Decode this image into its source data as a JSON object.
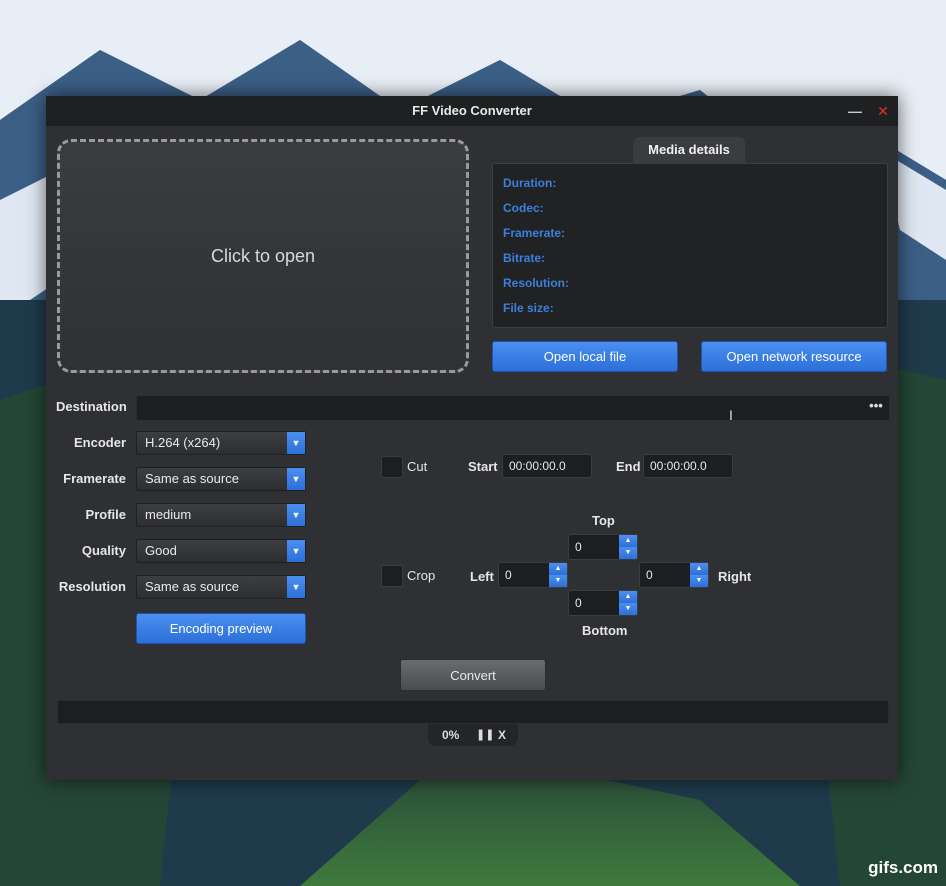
{
  "window": {
    "title": "FF Video Converter",
    "minimize_icon": "minimize-icon",
    "close_icon": "close-icon"
  },
  "dropzone": {
    "label": "Click to open"
  },
  "media_details": {
    "tab_label": "Media details",
    "rows": [
      "Duration:",
      "Codec:",
      "Framerate:",
      "Bitrate:",
      "Resolution:",
      "File size:"
    ]
  },
  "buttons": {
    "open_local": "Open local file",
    "open_network": "Open network resource",
    "encoding_preview": "Encoding preview",
    "convert": "Convert"
  },
  "destination": {
    "label": "Destination",
    "value": "",
    "browse": "•••"
  },
  "settings": {
    "encoder": {
      "label": "Encoder",
      "value": "H.264 (x264)"
    },
    "framerate": {
      "label": "Framerate",
      "value": "Same as source"
    },
    "profile": {
      "label": "Profile",
      "value": "medium"
    },
    "quality": {
      "label": "Quality",
      "value": "Good"
    },
    "resolution": {
      "label": "Resolution",
      "value": "Same as source"
    }
  },
  "cut": {
    "label": "Cut",
    "start_label": "Start",
    "start_value": "00:00:00.0",
    "end_label": "End",
    "end_value": "00:00:00.0"
  },
  "crop": {
    "label": "Crop",
    "top_label": "Top",
    "top_value": "0",
    "left_label": "Left",
    "left_value": "0",
    "right_label": "Right",
    "right_value": "0",
    "bottom_label": "Bottom",
    "bottom_value": "0"
  },
  "progress": {
    "percent_text": "0%",
    "pause_icon": "pause-icon",
    "cancel_label": "X",
    "fraction": 0
  },
  "watermark": "gifs.com",
  "colors": {
    "accent": "#2d6fd8",
    "detail_label": "#3d7fdc",
    "window_bg": "#2e3033"
  }
}
